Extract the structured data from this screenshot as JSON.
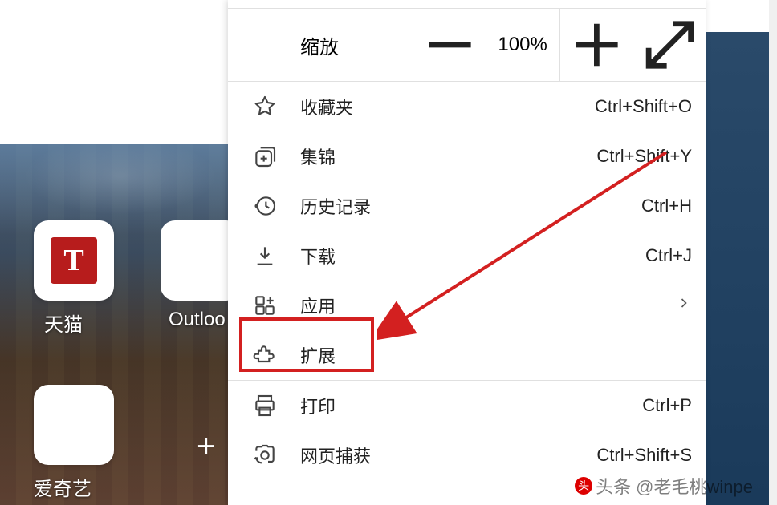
{
  "background": {
    "tiles": [
      {
        "label": "天猫",
        "icon_text": "T"
      },
      {
        "label": "爱奇艺"
      }
    ],
    "outlook_partial_label": "Outloo"
  },
  "menu": {
    "zoom": {
      "label": "缩放",
      "value": "100%"
    },
    "items": [
      {
        "icon": "star-icon",
        "label": "收藏夹",
        "shortcut": "Ctrl+Shift+O"
      },
      {
        "icon": "collections-icon",
        "label": "集锦",
        "shortcut": "Ctrl+Shift+Y"
      },
      {
        "icon": "history-icon",
        "label": "历史记录",
        "shortcut": "Ctrl+H"
      },
      {
        "icon": "download-icon",
        "label": "下载",
        "shortcut": "Ctrl+J"
      },
      {
        "icon": "apps-icon",
        "label": "应用",
        "has_submenu": true
      },
      {
        "icon": "extension-icon",
        "label": "扩展"
      },
      {
        "icon": "print-icon",
        "label": "打印",
        "shortcut": "Ctrl+P",
        "section_break_before": true
      },
      {
        "icon": "webcapture-icon",
        "label": "网页捕获",
        "shortcut": "Ctrl+Shift+S"
      }
    ]
  },
  "watermark": "头条 @老毛桃winpe"
}
